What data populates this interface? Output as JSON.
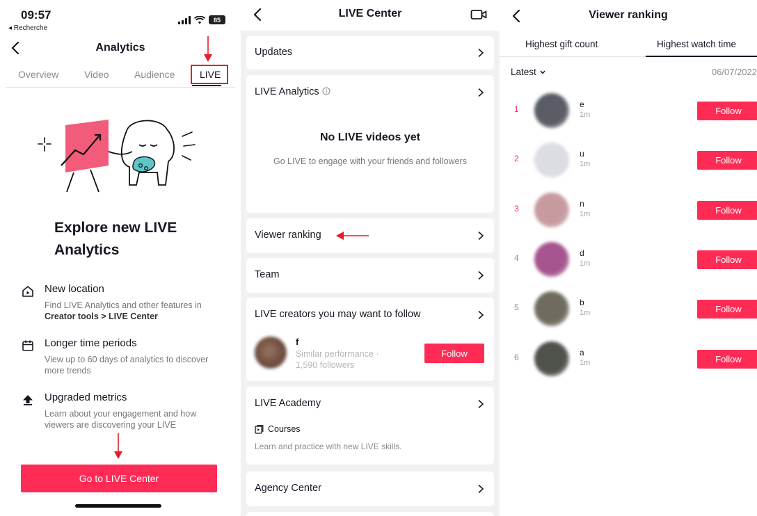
{
  "panel1": {
    "status": {
      "time": "09:57",
      "back_label": "◂ Recherche",
      "battery": "85"
    },
    "nav": {
      "title": "Analytics"
    },
    "tabs": [
      "Overview",
      "Video",
      "Audience",
      "LIVE"
    ],
    "headline": "Explore new LIVE Analytics",
    "features": [
      {
        "icon": "home-play-icon",
        "title": "New location",
        "desc_start": "Find LIVE Analytics and other features in ",
        "desc_bold": "Creator tools > LIVE Center"
      },
      {
        "icon": "calendar-icon",
        "title": "Longer time periods",
        "desc": "View up to 60 days of analytics to discover more trends"
      },
      {
        "icon": "upload-arrow-icon",
        "title": "Upgraded metrics",
        "desc": "Learn about your engagement and how viewers are discovering your LIVE"
      }
    ],
    "cta_label": "Go to LIVE Center"
  },
  "panel2": {
    "title": "LIVE Center",
    "updates_label": "Updates",
    "analytics_label": "LIVE Analytics",
    "empty_title": "No LIVE videos yet",
    "empty_desc": "Go LIVE to engage with your friends and followers",
    "viewer_ranking_label": "Viewer ranking",
    "team_label": "Team",
    "creators_label": "LIVE creators you may want to follow",
    "creator": {
      "name": "f",
      "sub1": "Similar performance ·",
      "sub2": "1,590 followers",
      "follow_label": "Follow"
    },
    "academy_label": "LIVE Academy",
    "courses_label": "Courses",
    "courses_desc": "Learn and practice with new LIVE skills.",
    "agency_label": "Agency Center"
  },
  "panel3": {
    "title": "Viewer ranking",
    "tabs": [
      "Highest gift count",
      "Highest watch time"
    ],
    "filter_label": "Latest",
    "date": "06/07/2022",
    "follow_label": "Follow",
    "viewers": [
      {
        "rank": "1",
        "name": "e",
        "time": "1m",
        "rank_color": "#fe2c55",
        "avatar_color": "#5a5c66"
      },
      {
        "rank": "2",
        "name": "u",
        "time": "1m",
        "rank_color": "#fe2c55",
        "avatar_color": "#dcdde2"
      },
      {
        "rank": "3",
        "name": "n",
        "time": "1m",
        "rank_color": "#fe2c55",
        "avatar_color": "#c79aa0"
      },
      {
        "rank": "4",
        "name": "d",
        "time": "1m",
        "rank_color": "#8a8b91",
        "avatar_color": "#a5548e"
      },
      {
        "rank": "5",
        "name": "b",
        "time": "1m",
        "rank_color": "#8a8b91",
        "avatar_color": "#6f6b5e"
      },
      {
        "rank": "6",
        "name": "a",
        "time": "1m",
        "rank_color": "#8a8b91",
        "avatar_color": "#4e524a"
      }
    ]
  },
  "colors": {
    "accent": "#fe2c55",
    "annotation_red": "#e41e2a",
    "text": "#161823",
    "muted": "#75767c"
  }
}
